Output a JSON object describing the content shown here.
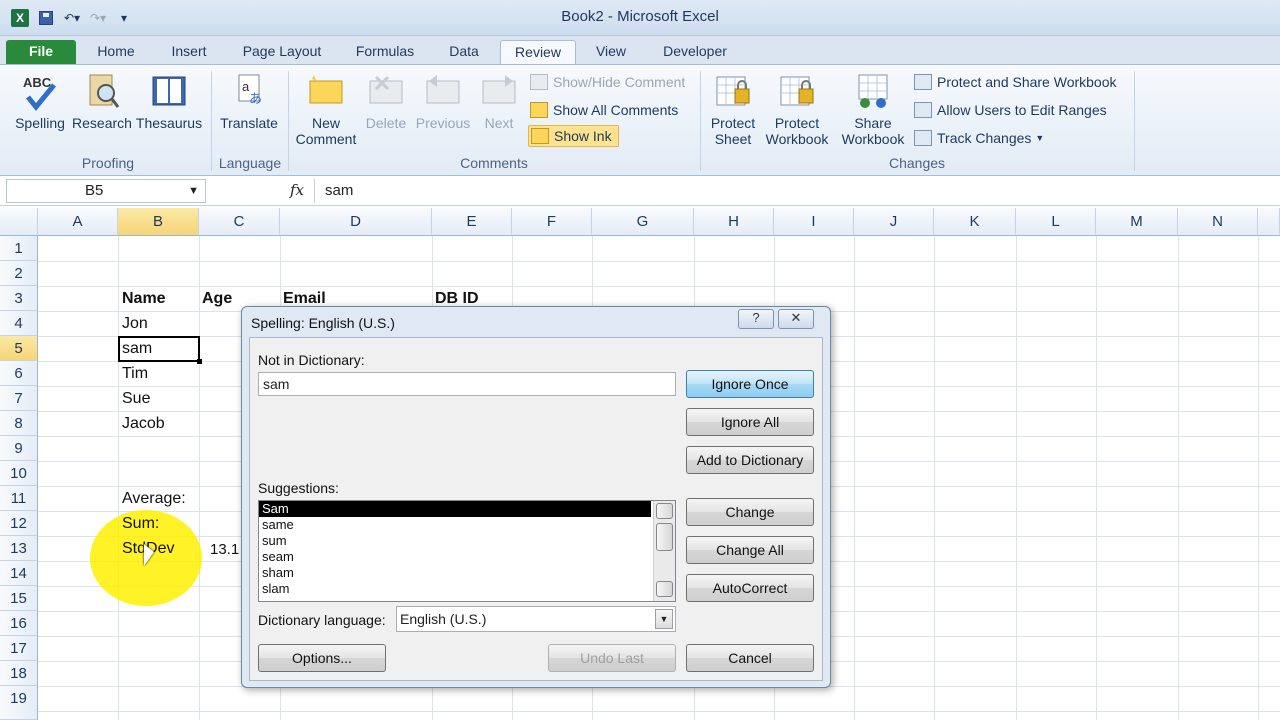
{
  "window": {
    "title": "Book2  -  Microsoft Excel"
  },
  "qat": {
    "app_icon": "excel-icon",
    "save": "save-icon",
    "undo": "undo-icon",
    "redo": "redo-icon"
  },
  "tabs": {
    "file": "File",
    "home": "Home",
    "insert": "Insert",
    "page_layout": "Page Layout",
    "formulas": "Formulas",
    "data": "Data",
    "review": "Review",
    "view": "View",
    "developer": "Developer"
  },
  "ribbon": {
    "proofing": {
      "label": "Proofing",
      "spelling": "Spelling",
      "research": "Research",
      "thesaurus": "Thesaurus"
    },
    "language": {
      "label": "Language",
      "translate": "Translate"
    },
    "comments": {
      "label": "Comments",
      "new_comment_1": "New",
      "new_comment_2": "Comment",
      "delete": "Delete",
      "previous": "Previous",
      "next": "Next",
      "show_hide": "Show/Hide Comment",
      "show_all": "Show All Comments",
      "show_ink": "Show Ink"
    },
    "changes": {
      "label": "Changes",
      "protect_sheet_1": "Protect",
      "protect_sheet_2": "Sheet",
      "protect_workbook_1": "Protect",
      "protect_workbook_2": "Workbook",
      "share_workbook_1": "Share",
      "share_workbook_2": "Workbook",
      "protect_share": "Protect and Share Workbook",
      "allow_users": "Allow Users to Edit Ranges",
      "track_changes": "Track Changes"
    }
  },
  "formula_bar": {
    "name_box": "B5",
    "fx": "fx",
    "value": "sam"
  },
  "sheet": {
    "columns": [
      "A",
      "B",
      "C",
      "D",
      "E",
      "F",
      "G",
      "H",
      "I",
      "J",
      "K",
      "L",
      "M",
      "N"
    ],
    "rows": [
      "1",
      "2",
      "3",
      "4",
      "5",
      "6",
      "7",
      "8",
      "9",
      "10",
      "11",
      "12",
      "13",
      "14",
      "15",
      "16",
      "17",
      "18",
      "19"
    ],
    "cells": {
      "B3": "Name",
      "C3": "Age",
      "D3": "Email",
      "E3": "DB ID",
      "B4": "Jon",
      "B5": "sam",
      "B6": "Tim",
      "B7": "Sue",
      "B8": "Jacob",
      "B11": "Average:",
      "B12": "Sum:",
      "B13": "StdDev",
      "C13": "13.1"
    }
  },
  "dialog": {
    "title": "Spelling: English (U.S.)",
    "help": "?",
    "close": "✕",
    "not_in_dict_label": "Not in Dictionary:",
    "not_in_dict_value": "sam",
    "suggestions_label": "Suggestions:",
    "suggestions": [
      "Sam",
      "same",
      "sum",
      "seam",
      "sham",
      "slam"
    ],
    "dict_lang_label": "Dictionary language:",
    "dict_lang_value": "English (U.S.)",
    "buttons": {
      "ignore_once": "Ignore Once",
      "ignore_all": "Ignore All",
      "add_to_dict": "Add to Dictionary",
      "change": "Change",
      "change_all": "Change All",
      "autocorrect": "AutoCorrect",
      "options": "Options...",
      "undo_last": "Undo Last",
      "cancel": "Cancel"
    }
  }
}
